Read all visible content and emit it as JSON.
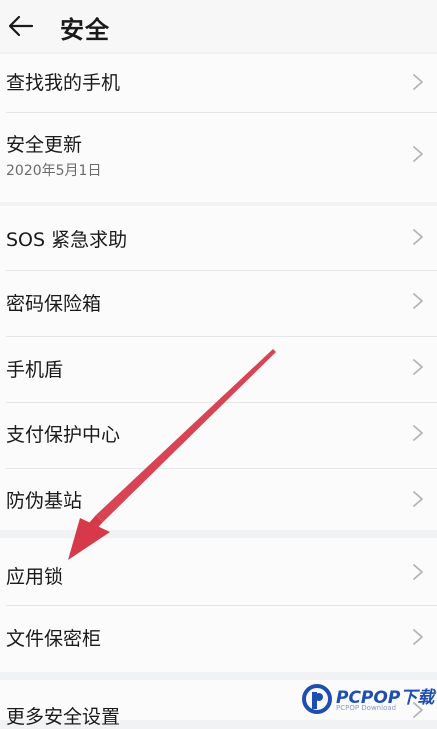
{
  "header": {
    "title": "安全",
    "back_icon": "arrow-left-icon"
  },
  "items": [
    {
      "label": "查找我的手机"
    },
    {
      "label": "安全更新",
      "sublabel": "2020年5月1日"
    },
    {
      "label": "SOS 紧急求助"
    },
    {
      "label": "密码保险箱"
    },
    {
      "label": "手机盾"
    },
    {
      "label": "支付保护中心"
    },
    {
      "label": "防伪基站"
    },
    {
      "label": "应用锁"
    },
    {
      "label": "文件保密柜"
    },
    {
      "label": "更多安全设置"
    }
  ],
  "watermark": {
    "brand": "PCPOP下载",
    "subtitle": "PCPOP Download"
  },
  "colors": {
    "annotation_arrow": "#d63a4a",
    "brand_blue": "#1e4fb0"
  }
}
